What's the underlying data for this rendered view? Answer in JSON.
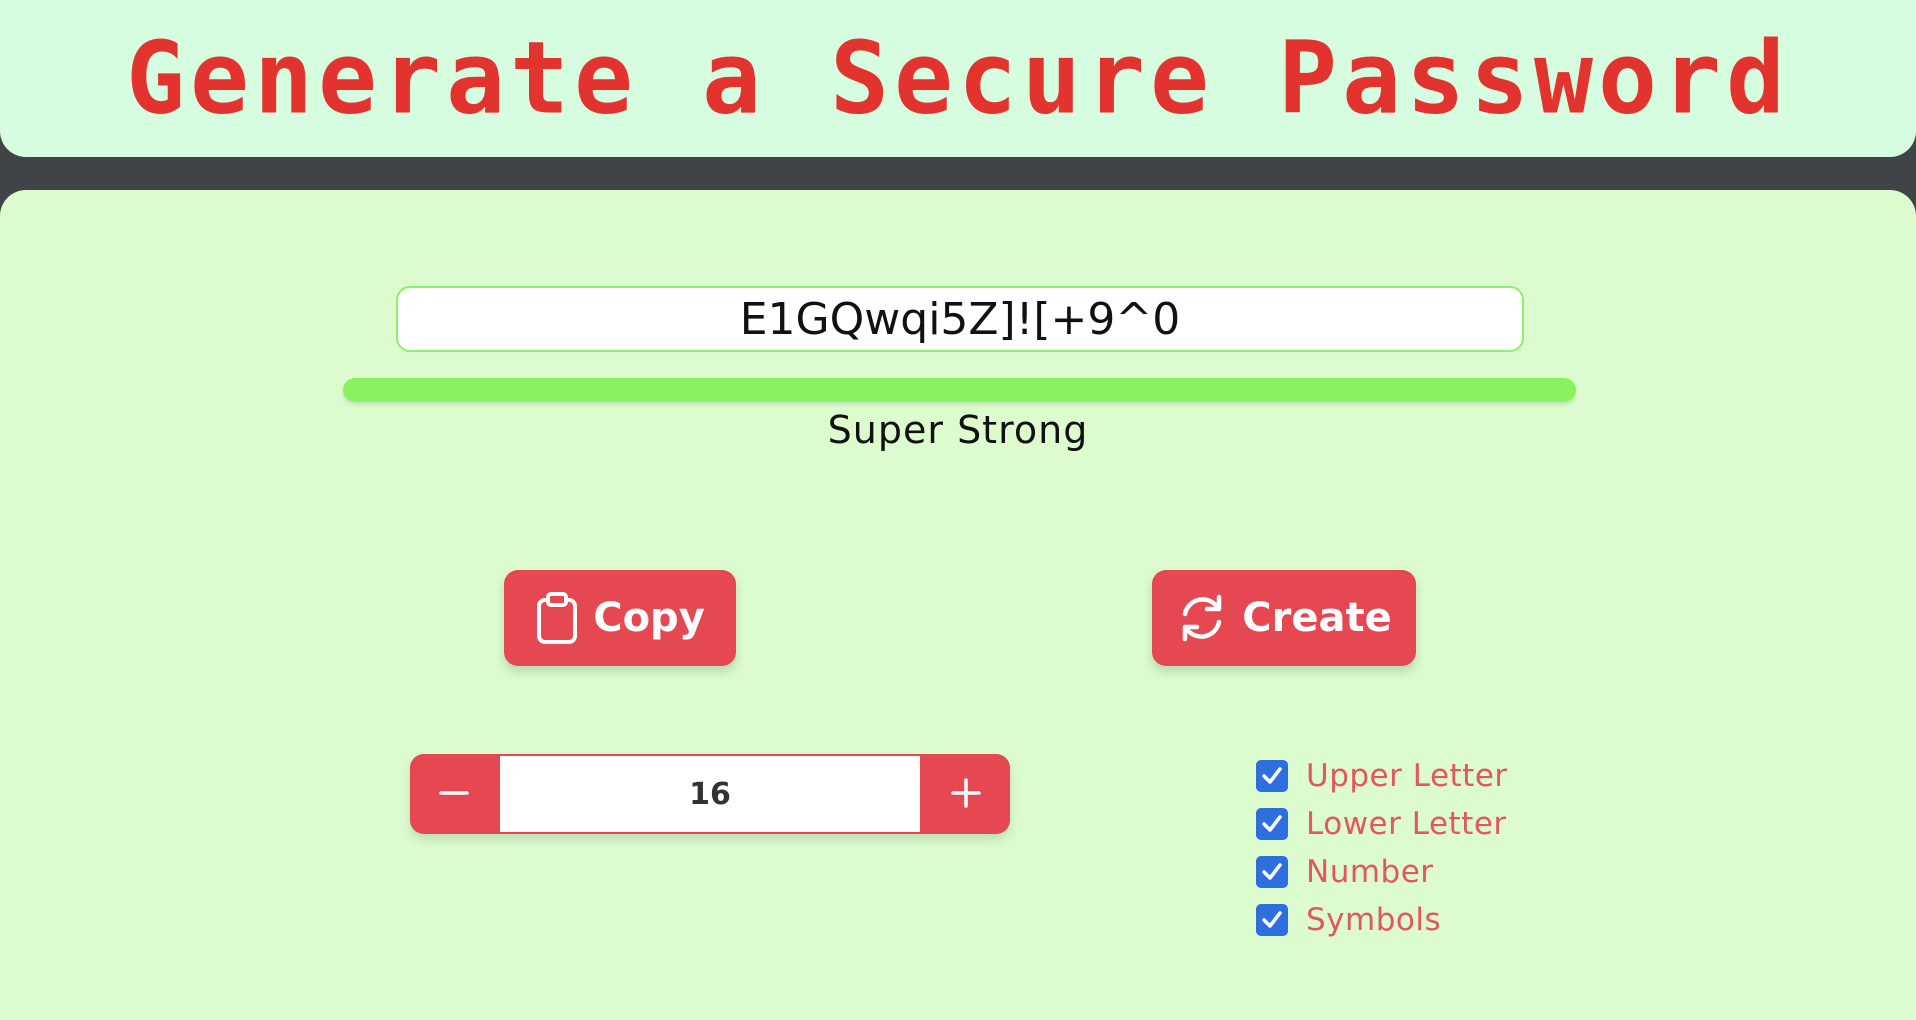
{
  "header": {
    "title": "Generate a Secure Password"
  },
  "password": {
    "value": "E1GQwqi5Z]![+9^0"
  },
  "strength": {
    "label": "Super Strong",
    "fill_fraction": 1.0,
    "color": "#88f35e"
  },
  "actions": {
    "copy_label": "Copy",
    "copy_icon": "clipboard-icon",
    "create_label": "Create",
    "create_icon": "refresh-icon"
  },
  "length": {
    "value": "16",
    "decrement_icon": "minus-icon",
    "increment_icon": "plus-icon"
  },
  "options": [
    {
      "label": "Upper Letter",
      "checked": true
    },
    {
      "label": "Lower Letter",
      "checked": true
    },
    {
      "label": "Number",
      "checked": true
    },
    {
      "label": "Symbols",
      "checked": true
    }
  ],
  "colors": {
    "accent": "#e64852",
    "title": "#e3332e",
    "header_bg": "#d6fde0",
    "main_bg": "#dcfcd0",
    "checkbox": "#2e6fe0"
  }
}
